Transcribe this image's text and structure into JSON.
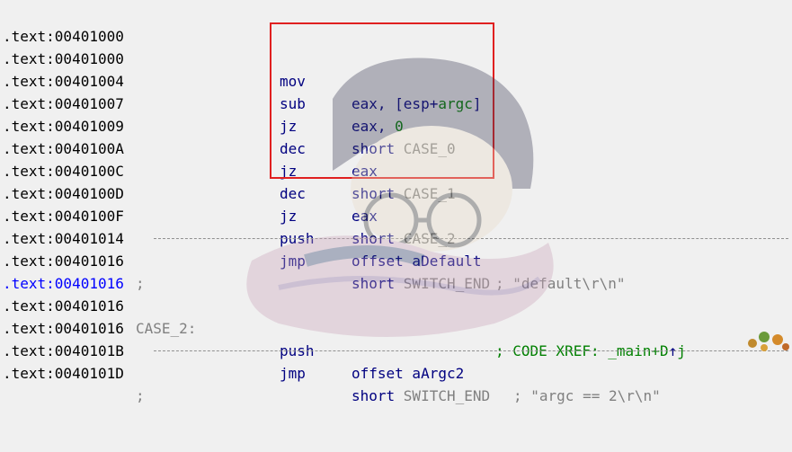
{
  "lines": [
    {
      "addr": ".text:00401000"
    },
    {
      "addr": ".text:00401000",
      "mnem": "mov",
      "op_pre": "eax, [esp+",
      "op_var": "argc",
      "op_post": "]"
    },
    {
      "addr": ".text:00401004",
      "mnem": "sub",
      "op_pre": "eax, ",
      "op_num": "0"
    },
    {
      "addr": ".text:00401007",
      "mnem": "jz",
      "op_pre": "short ",
      "op_gray": "CASE_0"
    },
    {
      "addr": ".text:00401009",
      "mnem": "dec",
      "op_pre": "eax"
    },
    {
      "addr": ".text:0040100A",
      "mnem": "jz",
      "op_pre": "short ",
      "op_gray": "CASE_1"
    },
    {
      "addr": ".text:0040100C",
      "mnem": "dec",
      "op_pre": "eax"
    },
    {
      "addr": ".text:0040100D",
      "mnem": "jz",
      "op_pre": "short ",
      "op_gray": "CASE_2"
    },
    {
      "addr": ".text:0040100F",
      "mnem": "push",
      "op_pre": "offset aDefault",
      "comment": "; \"default\\r\\n\""
    },
    {
      "addr": ".text:00401014",
      "mnem": "jmp",
      "op_pre": "short ",
      "op_gray": "SWITCH_END"
    },
    {
      "addr": ".text:00401016",
      "separator": ";"
    },
    {
      "addr": ".text:00401016",
      "highlight": true
    },
    {
      "addr": ".text:00401016",
      "label": "CASE_2:",
      "xref_text": "; CODE XREF: _main+D",
      "xref_arrow": "↑",
      "xref_suffix": "j"
    },
    {
      "addr": ".text:00401016",
      "mnem": "push",
      "op_pre": "offset aArgc2",
      "comment": "; \"argc == 2\\r\\n\""
    },
    {
      "addr": ".text:0040101B",
      "mnem": "jmp",
      "op_pre": "short ",
      "op_gray": "SWITCH_END"
    },
    {
      "addr": ".text:0040101D",
      "separator": ";"
    }
  ],
  "colors": {
    "highlight_box": "#e02020",
    "address": "#000000",
    "selected_address": "#0000ff"
  }
}
